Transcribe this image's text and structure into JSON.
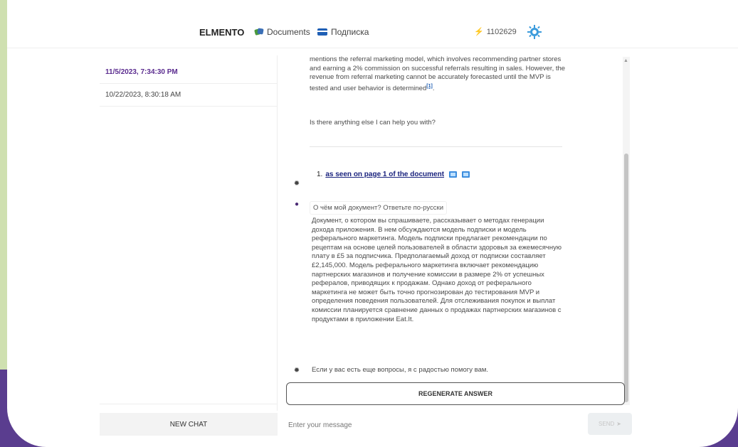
{
  "header": {
    "brand": "ELMENTO",
    "nav_documents": "Documents",
    "nav_subscription": "Подписка",
    "credits": "1102629"
  },
  "sidebar": {
    "sessions": [
      {
        "label": "11/5/2023, 7:34:30 PM",
        "active": true
      },
      {
        "label": "10/22/2023, 8:30:18 AM",
        "active": false
      }
    ],
    "new_chat": "NEW CHAT"
  },
  "chat": {
    "assistant_1_text": "mentions the referral marketing model, which involves recommending partner stores and earning a 2% commission on successful referrals resulting in sales. However, the revenue from referral marketing cannot be accurately forecasted until the MVP is tested and user behavior is determined",
    "assistant_1_citation": "[1]",
    "assistant_1_end": ".",
    "assistant_1_followup": "Is there anything else I can help you with?",
    "reference_number": "1.",
    "reference_link": "as seen on page 1 of the document",
    "user_message": "О чём мой документ? Ответьте по-русски",
    "assistant_2_text": "Документ, о котором вы спрашиваете, рассказывает о методах генерации дохода приложения. В нем обсуждаются модель подписки и модель реферального маркетинга. Модель подписки предлагает рекомендации по рецептам на основе целей пользователей в области здоровья за ежемесячную плату в £5 за подписчика. Предполагаемый доход от подписки составляет £2,145,000. Модель реферального маркетинга включает рекомендацию партнерских магазинов и получение комиссии в размере 2% от успешных рефералов, приводящих к продажам. Однако доход от реферального маркетинга не может быть точно прогнозирован до тестирования MVP и определения поведения пользователей. Для отслеживания покупок и выплат комиссии планируется сравнение данных о продажах партнерских магазинов с продуктами в приложении Eat.It.",
    "assistant_2_closing": "Если у вас есть еще вопросы, я с радостью помогу вам.",
    "regenerate_label": "REGENERATE ANSWER"
  },
  "composer": {
    "placeholder": "Enter your message",
    "send_label": "SEND"
  },
  "colors": {
    "accent_purple": "#5b2c8f",
    "background_purple": "#5a3d8f",
    "left_strip_green": "#cfe0b0",
    "link_blue": "#1a237e",
    "credit_bolt": "#f2a10c"
  },
  "icons": [
    "documents-icon",
    "card-icon",
    "bolt-icon",
    "gear-icon",
    "bot-avatar-icon",
    "user-avatar-icon",
    "page-icon",
    "send-icon"
  ]
}
